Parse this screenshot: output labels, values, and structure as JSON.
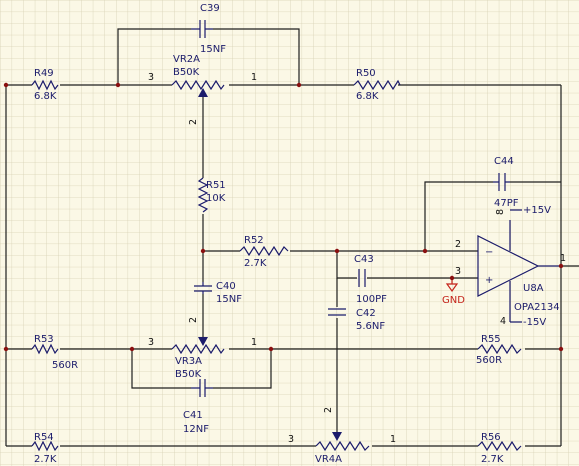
{
  "colors": {
    "background": "#fbf8e6",
    "grid": "#d7d1b4",
    "wire": "#1f1f1f",
    "part": "#1b1b6b",
    "power": "#c4231a"
  },
  "components": {
    "c39": {
      "ref": "C39",
      "value": "15NF"
    },
    "vr2a": {
      "ref": "VR2A",
      "value": "B50K",
      "pin_a": "3",
      "pin_b": "1",
      "pin_w": "2"
    },
    "r49": {
      "ref": "R49",
      "value": "6.8K"
    },
    "r50": {
      "ref": "R50",
      "value": "6.8K"
    },
    "r51": {
      "ref": "R51",
      "value": "10K"
    },
    "r52": {
      "ref": "R52",
      "value": "2.7K"
    },
    "c40": {
      "ref": "C40",
      "value": "15NF"
    },
    "c43": {
      "ref": "C43",
      "value": "100PF"
    },
    "c42": {
      "ref": "C42",
      "value": "5.6NF"
    },
    "c44": {
      "ref": "C44",
      "value": "47PF"
    },
    "u8a": {
      "ref": "U8A",
      "part": "OPA2134",
      "pin_in_neg": "2",
      "pin_in_pos": "3",
      "pin_out": "1",
      "pin_vpos": "8",
      "pin_vneg": "4",
      "vpos": "+15V",
      "vneg": "-15V",
      "minus_sign": "−",
      "plus_sign": "+"
    },
    "gnd": {
      "label": "GND"
    },
    "r53": {
      "ref": "R53",
      "value": "560R"
    },
    "r55": {
      "ref": "R55",
      "value": "560R"
    },
    "vr3a": {
      "ref": "VR3A",
      "value": "B50K",
      "pin_a": "3",
      "pin_b": "1",
      "pin_w": "2"
    },
    "c41": {
      "ref": "C41",
      "value": "12NF"
    },
    "r54": {
      "ref": "R54",
      "value": "2.7K"
    },
    "r56": {
      "ref": "R56",
      "value": "2.7K"
    },
    "vr4a": {
      "ref": "VR4A",
      "pin_a": "3",
      "pin_b": "1",
      "pin_w": "2"
    }
  }
}
